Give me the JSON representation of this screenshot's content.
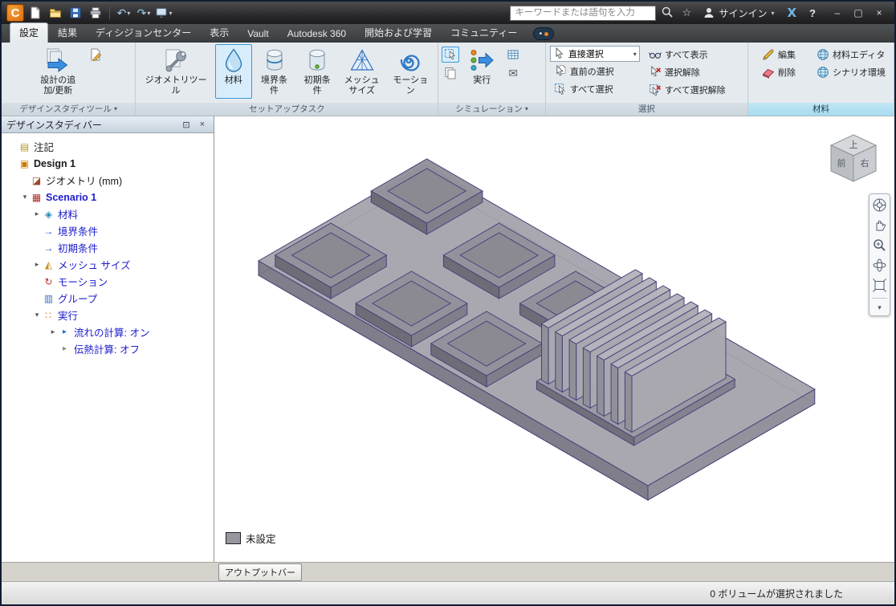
{
  "titlebar": {
    "search_placeholder": "キーワードまたは語句を入力",
    "signin": "サインイン"
  },
  "tabs": {
    "active": "設定",
    "items": [
      {
        "label": "設定"
      },
      {
        "label": "結果"
      },
      {
        "label": "ディシジョンセンター"
      },
      {
        "label": "表示"
      },
      {
        "label": "Vault"
      },
      {
        "label": "Autodesk 360"
      },
      {
        "label": "開始および学習"
      },
      {
        "label": "コミュニティー"
      }
    ]
  },
  "ribbon": {
    "groups": {
      "design_study": {
        "label": "デザインスタディツール",
        "add_update": "設計の追加/更新"
      },
      "setup": {
        "label": "セットアップタスク",
        "geometry_tools": "ジオメトリツール",
        "materials": "材料",
        "boundary": "境界条件",
        "initial": "初期条件",
        "mesh": "メッシュ サイズ",
        "motion": "モーション"
      },
      "simulation": {
        "label": "シミュレーション",
        "solve": "実行"
      },
      "selection": {
        "label": "選択",
        "direct": "直接選択",
        "previous": "直前の選択",
        "select_all": "すべて選択",
        "show_all": "すべて表示",
        "deselect": "選択解除",
        "deselect_all": "すべて選択解除"
      },
      "material": {
        "label": "材料",
        "edit": "編集",
        "delete": "削除",
        "editor": "材料エディタ",
        "scenario_env": "シナリオ環境"
      }
    }
  },
  "design_study_bar": {
    "title": "デザインスタディバー",
    "items": [
      {
        "label": "注記",
        "icon": "▤"
      },
      {
        "label": "Design 1",
        "icon": "▣"
      },
      {
        "label": "ジオメトリ (mm)",
        "icon": "◪"
      },
      {
        "label": "Scenario 1",
        "icon": "▦",
        "arrow": "▾"
      },
      {
        "label": "材料",
        "icon": "◈",
        "arrow": "▸"
      },
      {
        "label": "境界条件",
        "icon": "→"
      },
      {
        "label": "初期条件",
        "icon": "→"
      },
      {
        "label": "メッシュ サイズ",
        "icon": "◭",
        "arrow": "▸"
      },
      {
        "label": "モーション",
        "icon": "↻"
      },
      {
        "label": "グループ",
        "icon": "▥"
      },
      {
        "label": "実行",
        "icon": "∷",
        "arrow": "▾"
      },
      {
        "label": "流れの計算: オン",
        "icon": "▸",
        "arrow": "▸"
      },
      {
        "label": "伝熱計算: オフ",
        "icon": "▸"
      }
    ]
  },
  "viewport": {
    "legend_label": "未設定",
    "viewcube": {
      "top": "上",
      "left": "前",
      "right": "右"
    }
  },
  "bottom": {
    "output_bar": "アウトプットバー",
    "status": "0 ボリュームが選択されました"
  },
  "icons": {
    "dropdown": "▾",
    "undo": "↶",
    "redo": "↷",
    "star": "☆",
    "help": "?",
    "x_logo": "X",
    "minimize": "–",
    "maximize": "▢",
    "close": "×",
    "pin": "⊡",
    "panel_close": "×",
    "envelope": "✉",
    "more": "▾"
  },
  "colors": {
    "accent_blue": "#2e8ddb",
    "active_highlight": "#d8edfb",
    "selection_border": "#3a9ad9",
    "brand_orange": "#e87e16",
    "model_edge_purple": "#46437a",
    "model_gray": "#9b9aa3"
  }
}
